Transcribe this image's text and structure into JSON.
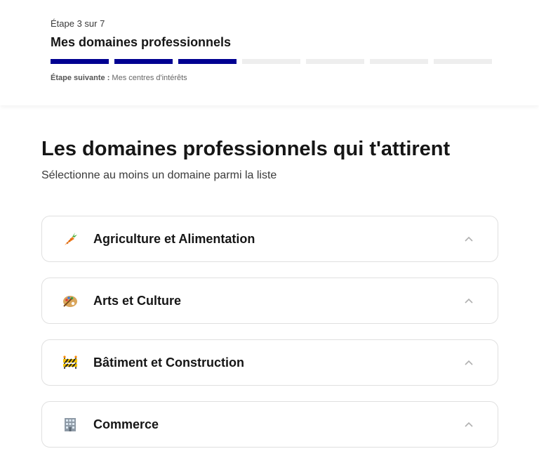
{
  "stepper": {
    "step_label": "Étape 3 sur 7",
    "title": "Mes domaines professionnels",
    "progress": {
      "current": 3,
      "total": 7
    },
    "next_prefix": "Étape suivante :",
    "next_value": "Mes centres d'intérêts",
    "accent_color": "#000091"
  },
  "main": {
    "title": "Les domaines professionnels qui t'attirent",
    "subtitle": "Sélectionne au moins un domaine parmi la liste"
  },
  "domains": [
    {
      "label": "Agriculture et Alimentation",
      "icon": "carrot-icon"
    },
    {
      "label": "Arts et Culture",
      "icon": "palette-icon"
    },
    {
      "label": "Bâtiment et Construction",
      "icon": "construction-barrier-icon"
    },
    {
      "label": "Commerce",
      "icon": "office-building-icon"
    }
  ]
}
